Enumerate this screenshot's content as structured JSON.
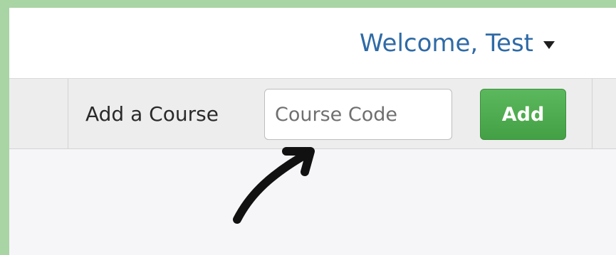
{
  "topbar": {
    "welcome_text": "Welcome, Test",
    "welcome_icon": "caret-down-icon"
  },
  "toolbar": {
    "add_course_label": "Add a Course",
    "course_code_placeholder": "Course Code",
    "course_code_value": "",
    "add_button_label": "Add"
  },
  "annotation": {
    "arrow_icon": "hand-drawn-arrow-icon",
    "arrow_color": "#111111"
  },
  "colors": {
    "frame_green": "#a9d4a4",
    "link_blue": "#2f6aa6",
    "button_green": "#4cae4c"
  }
}
